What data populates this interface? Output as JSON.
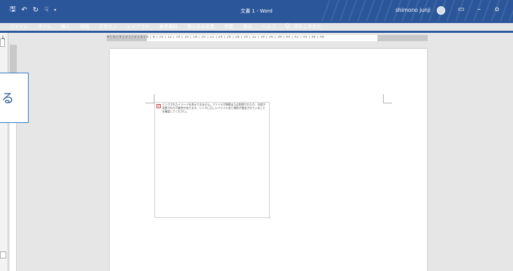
{
  "window": {
    "doc_title": "文書 1  -  Word",
    "user_name": "shimono junji",
    "controls": {
      "restore": "▭",
      "minimize": "–",
      "close": "o"
    }
  },
  "quick_access": {
    "save": "🖫",
    "undo": "↶",
    "redo": "↻",
    "touch": "☟",
    "customize": "▾"
  },
  "ribbon_tabs": [
    "ファイル",
    "ホーム",
    "挿入",
    "描画",
    "デザイン",
    "レイアウト",
    "参考資料",
    "差し込み文書",
    "校閲",
    "表示",
    "ヘルプ"
  ],
  "tell_me": {
    "icon": "lightbulb-icon",
    "label": "何をしますか"
  },
  "ruler": {
    "text": "8 | 6 | 4 | 2 |  | 2 | 4 | 6 | 8 | 10 | 12 | 14 | 16 | 18 | 20 | 22 | 24 | 26 | 28 | 30 | 32 | 34 | 36 | 38 | 40 | 42 | 44 | 46 | 48"
  },
  "document": {
    "broken_image_text": "リンクされたイメージを表示できません。ファイルが移動または削除されたか、名前が変更された可能性があります。リンクに正しいファイル名と場所が指定されていることを確認してください。"
  },
  "tooltip": {
    "text": "る"
  },
  "colors": {
    "accent": "#2b579a"
  }
}
